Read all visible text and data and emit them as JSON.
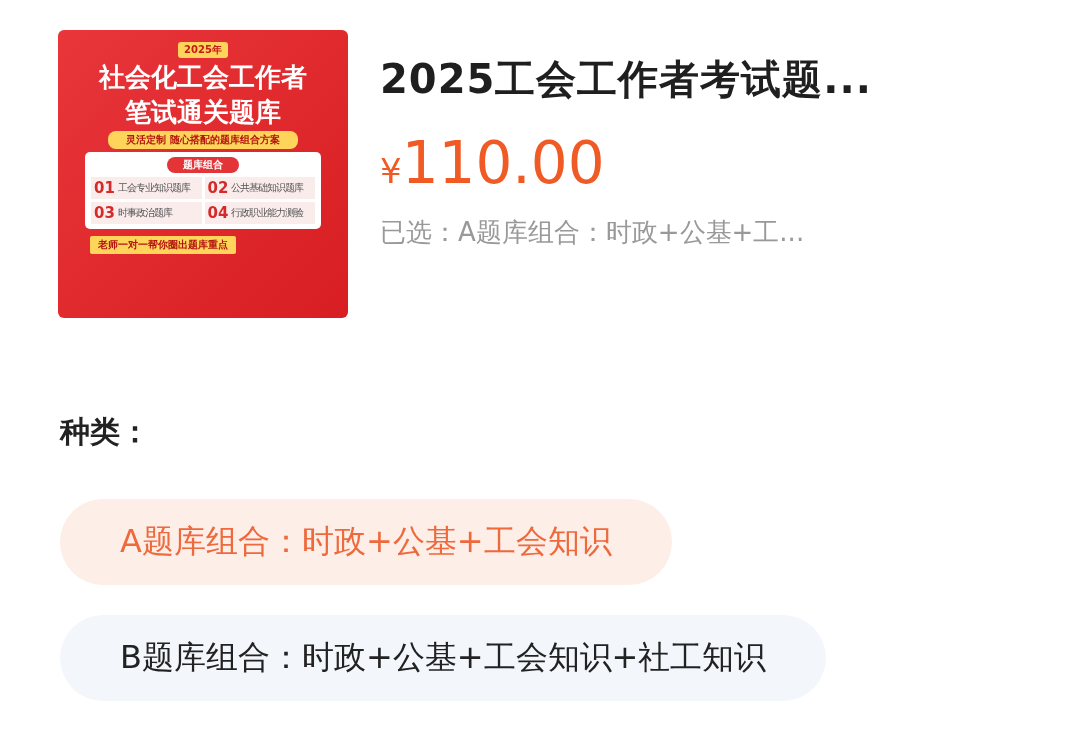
{
  "product": {
    "cover": {
      "year": "2025年",
      "title_lines": [
        "社会化工会工作者",
        "笔试通关题库"
      ],
      "tagline": "灵活定制  随心搭配的题库组合方案",
      "section": "题库组合",
      "modules": [
        {
          "number": "01",
          "name": "工会专业知识题库"
        },
        {
          "number": "02",
          "name": "公共基础知识题库"
        },
        {
          "number": "03",
          "name": "时事政治题库"
        },
        {
          "number": "04",
          "name": "行政职业能力测验"
        }
      ],
      "footer": "老师一对一帮你圈出题库重点"
    },
    "title": "2025工会工作者考试题...",
    "currency": "¥",
    "price": "110.00",
    "selected_summary": "已选：A题库组合：时政+公基+工..."
  },
  "variant_label": "种类：",
  "variants": [
    {
      "label": "A题库组合：时政+公基+工会知识",
      "selected": true
    },
    {
      "label": "B题库组合：时政+公基+工会知识+社工知识",
      "selected": false
    }
  ]
}
